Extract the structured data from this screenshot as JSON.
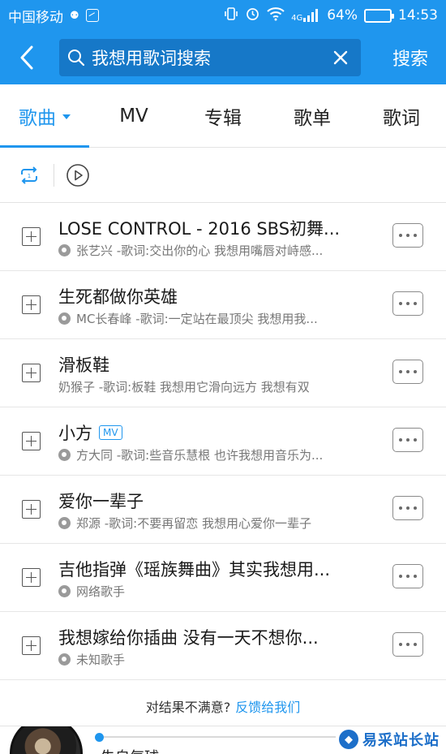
{
  "status_bar": {
    "carrier": "中国移动",
    "network": "4G",
    "battery_percent": "64%",
    "battery_level": 0.64,
    "time": "14:53"
  },
  "header": {
    "search_query": "我想用歌词搜索",
    "search_button_label": "搜索",
    "accent_color": "#1f96ee"
  },
  "tabs": [
    {
      "label": "歌曲",
      "active": true
    },
    {
      "label": "MV",
      "active": false
    },
    {
      "label": "专辑",
      "active": false
    },
    {
      "label": "歌单",
      "active": false
    },
    {
      "label": "歌词",
      "active": false
    }
  ],
  "controls": {
    "repeat_icon": "repeat-icon",
    "play_icon": "play-circle-icon"
  },
  "songs": [
    {
      "title": "LOSE CONTROL - 2016 SBS初舞...",
      "subtitle": "张艺兴 -歌词:交出你的心 我想用嘴唇对峙感...",
      "mv": false,
      "icon": true
    },
    {
      "title": "生死都做你英雄",
      "subtitle": "MC长春峰 -歌词:一定站在最顶尖 我想用我...",
      "mv": false,
      "icon": true
    },
    {
      "title": "滑板鞋",
      "subtitle": "奶猴子 -歌词:板鞋 我想用它滑向远方 我想有双",
      "mv": false,
      "icon": false
    },
    {
      "title": "小方",
      "subtitle": "方大同 -歌词:些音乐慧根 也许我想用音乐为...",
      "mv": true,
      "mv_label": "MV",
      "icon": true
    },
    {
      "title": "爱你一辈子",
      "subtitle": "郑源 -歌词:不要再留恋 我想用心爱你一辈子",
      "mv": false,
      "icon": true
    },
    {
      "title": "吉他指弹《瑶族舞曲》其实我想用...",
      "subtitle": "网络歌手",
      "mv": false,
      "icon": true
    },
    {
      "title": "我想嫁给你插曲 没有一天不想你...",
      "subtitle": "未知歌手",
      "mv": false,
      "icon": true
    }
  ],
  "feedback": {
    "prompt": "对结果不满意?",
    "link": "反馈给我们"
  },
  "player": {
    "now_playing_title": "失自气球",
    "progress": 0.0
  },
  "watermark": {
    "text": "易采站长站"
  }
}
